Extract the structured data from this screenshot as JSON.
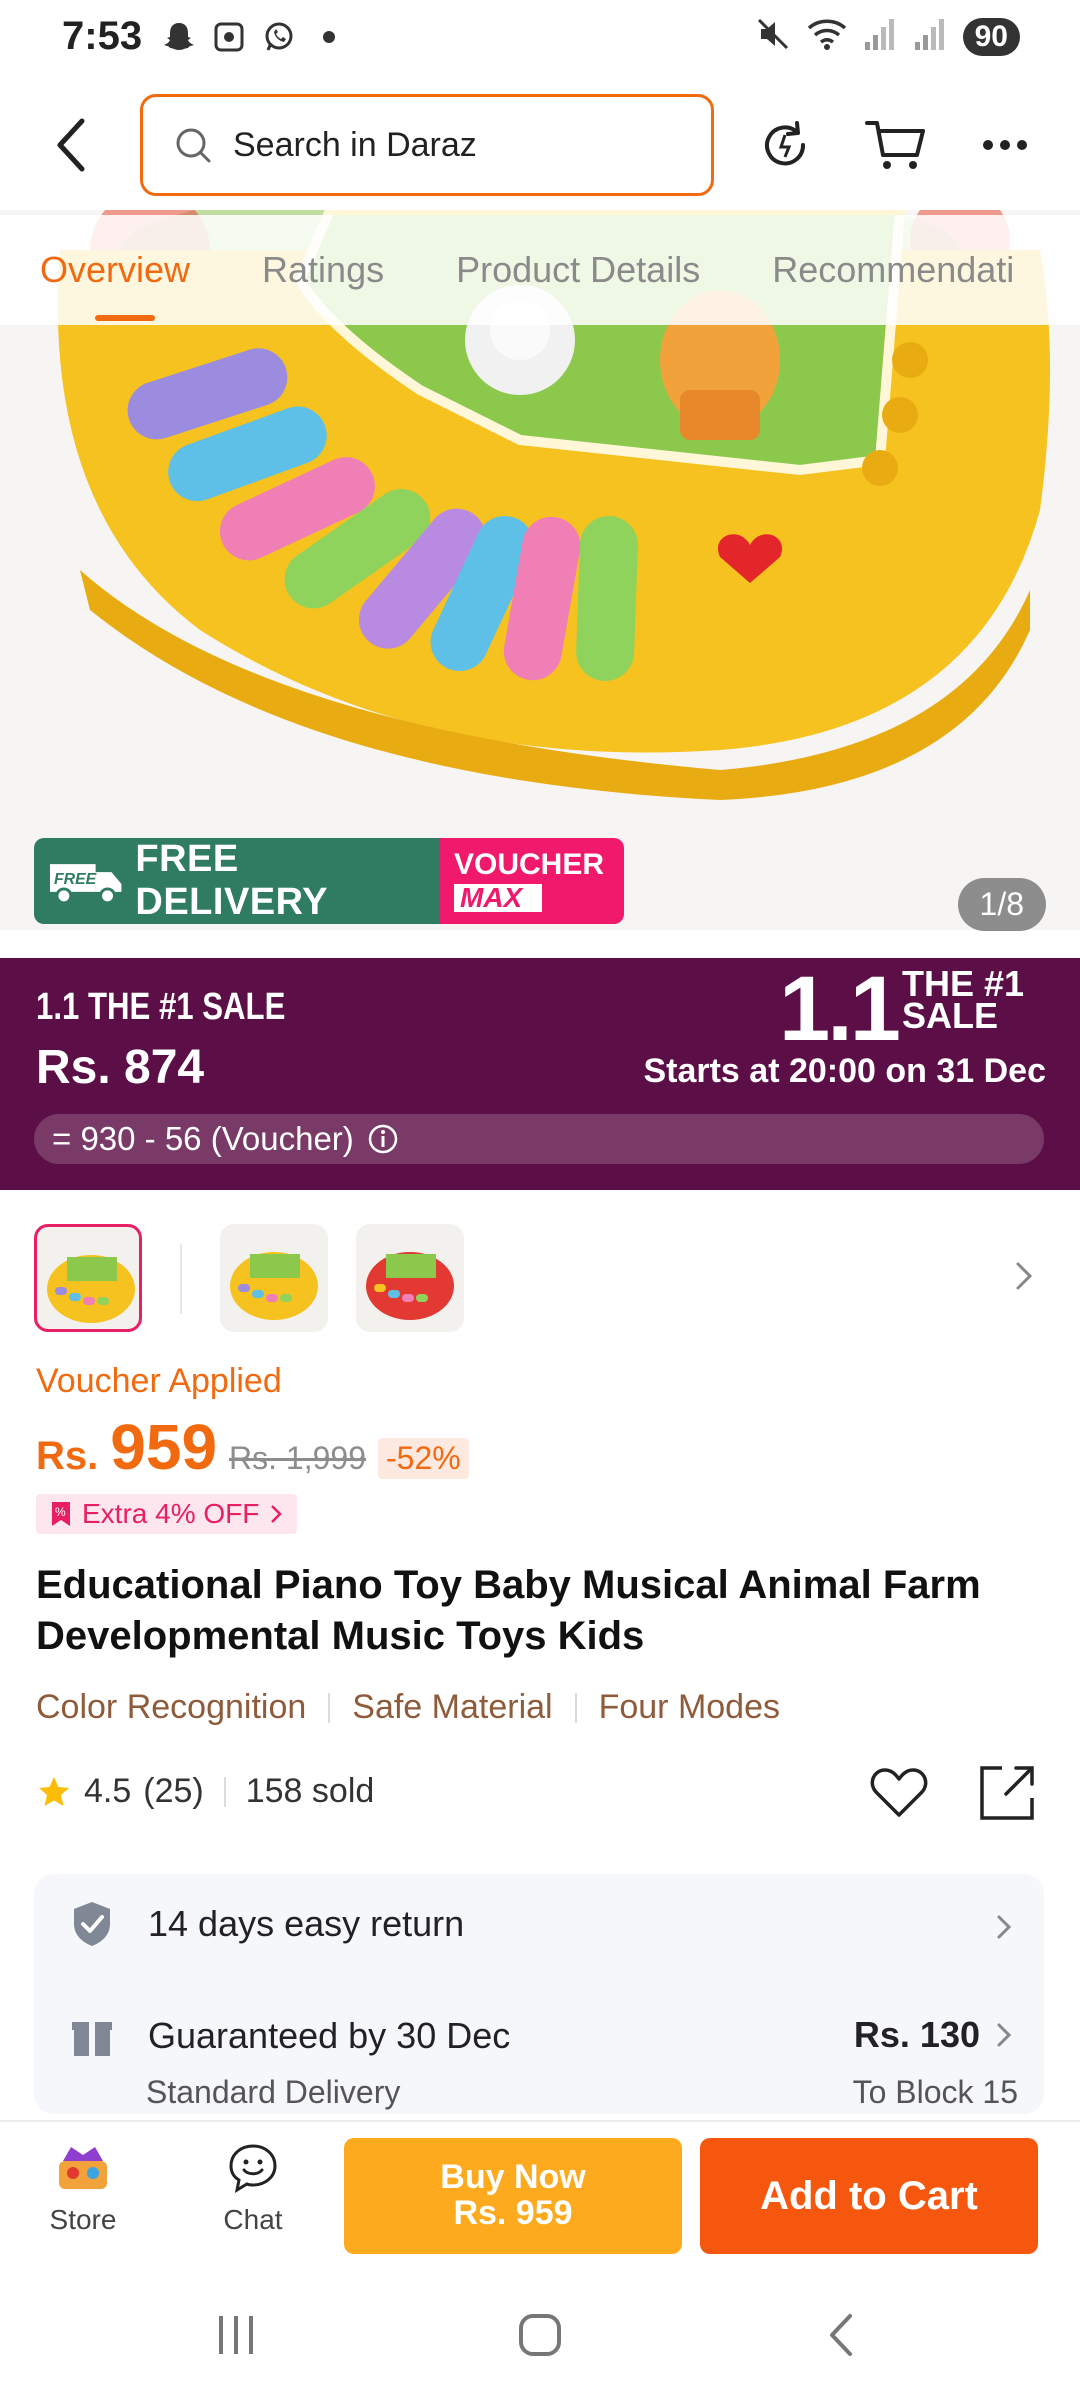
{
  "status_bar": {
    "time": "7:53",
    "battery": "90"
  },
  "search": {
    "placeholder": "Search in Daraz"
  },
  "tabs": [
    {
      "label": "Overview"
    },
    {
      "label": "Ratings"
    },
    {
      "label": "Product Details"
    },
    {
      "label": "Recommendati"
    }
  ],
  "hero": {
    "free_delivery": "FREE DELIVERY",
    "free_badge": "FREE",
    "voucher_line1": "VOUCHER",
    "voucher_line2": "MAX",
    "counter": "1/8"
  },
  "sale": {
    "title": "1.1 THE #1 SALE",
    "price": "Rs. 874",
    "starts": "Starts at 20:00 on 31 Dec",
    "voucher_calc": "= 930 - 56 (Voucher)",
    "logo_big": "1.1",
    "logo_small1": "THE #1",
    "logo_small2": "SALE"
  },
  "product": {
    "voucher_applied": "Voucher Applied",
    "currency": "Rs.",
    "price": "959",
    "old_price": "Rs. 1,999",
    "discount": "-52%",
    "extra_off": "Extra 4% OFF",
    "title": "Educational Piano Toy Baby Musical Animal Farm Developmental Music Toys Kids",
    "features": [
      "Color Recognition",
      "Safe Material",
      "Four Modes"
    ],
    "rating": "4.5",
    "reviews": "(25)",
    "sold": "158 sold"
  },
  "delivery": {
    "return": "14 days easy return",
    "guarantee": "Guaranteed by 30 Dec",
    "method": "Standard Delivery",
    "fee": "Rs. 130",
    "location": "To Block 15"
  },
  "bottom_bar": {
    "store": "Store",
    "chat": "Chat",
    "buy_now": "Buy Now",
    "buy_price": "Rs. 959",
    "add_to_cart": "Add to Cart"
  },
  "colors": {
    "accent": "#f26a10",
    "sale_bg": "#5c0f47",
    "buy_now": "#fdaa1e",
    "add_to_cart": "#f6570f"
  }
}
